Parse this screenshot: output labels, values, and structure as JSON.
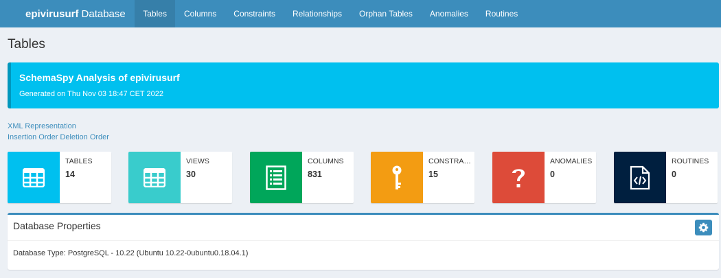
{
  "navbar": {
    "brand_bold": "epivirusurf",
    "brand_rest": "Database",
    "items": [
      {
        "label": "Tables"
      },
      {
        "label": "Columns"
      },
      {
        "label": "Constraints"
      },
      {
        "label": "Relationships"
      },
      {
        "label": "Orphan Tables"
      },
      {
        "label": "Anomalies"
      },
      {
        "label": "Routines"
      }
    ],
    "active_item": "Tables"
  },
  "page": {
    "title": "Tables"
  },
  "callout": {
    "title": "SchemaSpy Analysis of epivirusurf",
    "subtitle": "Generated on Thu Nov 03 18:47 CET 2022"
  },
  "links": {
    "xml": "XML Representation",
    "insertion_order": "Insertion Order Deletion Order"
  },
  "stats": [
    {
      "label": "TABLES",
      "value": "14",
      "icon": "table-icon",
      "color": "#00c0ef"
    },
    {
      "label": "VIEWS",
      "value": "30",
      "icon": "table-icon",
      "color": "#39cccc"
    },
    {
      "label": "COLUMNS",
      "value": "831",
      "icon": "list-icon",
      "color": "#00a65a"
    },
    {
      "label": "CONSTRAINTS",
      "value": "15",
      "icon": "key-icon",
      "color": "#f39c12"
    },
    {
      "label": "ANOMALIES",
      "value": "0",
      "icon": "question-icon",
      "color": "#dd4b39"
    },
    {
      "label": "ROUTINES",
      "value": "0",
      "icon": "code-file-icon",
      "color": "#001f3f"
    }
  ],
  "database_properties": {
    "title": "Database Properties",
    "type_line": "Database Type: PostgreSQL - 10.22 (Ubuntu 10.22-0ubuntu0.18.04.1)",
    "tool_icon": "gear-icon"
  }
}
